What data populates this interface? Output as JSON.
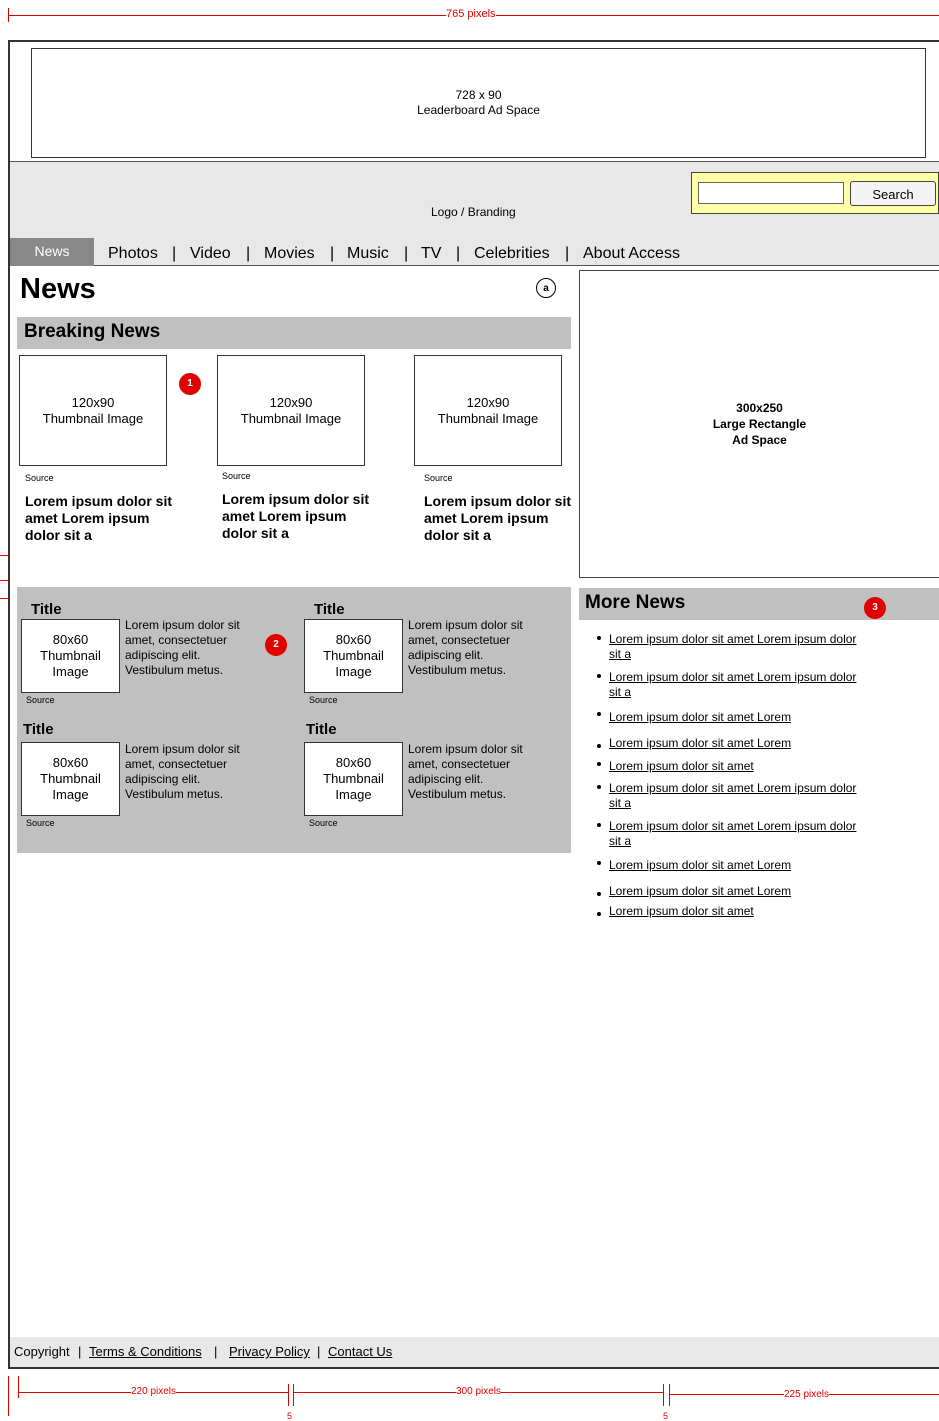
{
  "dimensions": {
    "total_width": "765 pixels",
    "col1": "220 pixels",
    "col2": "300 pixels",
    "col3": "225 pixels",
    "gap1": "5",
    "gap2": "5"
  },
  "leaderboard": {
    "line1": "728 x 90",
    "line2": "Leaderboard Ad Space"
  },
  "header": {
    "logo": "Logo / Branding",
    "search_button": "Search",
    "search_value": ""
  },
  "nav": {
    "active": "News",
    "items": [
      "Photos",
      "Video",
      "Movies",
      "Music",
      "TV",
      "Celebrities",
      "About Access"
    ],
    "separator": "|"
  },
  "page": {
    "title": "News",
    "marker_a": "a"
  },
  "breaking": {
    "heading": "Breaking News",
    "marker": "1",
    "items": [
      {
        "thumb_size": "120x90",
        "thumb_label": "Thumbnail Image",
        "source": "Source",
        "headline": "Lorem ipsum dolor sit amet Lorem ipsum dolor sit a"
      },
      {
        "thumb_size": "120x90",
        "thumb_label": "Thumbnail Image",
        "source": "Source",
        "headline": "Lorem ipsum dolor sit amet Lorem ipsum dolor sit a"
      },
      {
        "thumb_size": "120x90",
        "thumb_label": "Thumbnail Image",
        "source": "Source",
        "headline": "Lorem ipsum dolor sit amet Lorem ipsum dolor sit a"
      }
    ]
  },
  "stories": {
    "marker": "2",
    "items": [
      {
        "title": "Title",
        "thumb_size": "80x60",
        "thumb_l1": "Thumbnail",
        "thumb_l2": "Image",
        "source": "Source",
        "text": "Lorem ipsum dolor sit amet, consectetuer adipiscing elit. Vestibulum metus."
      },
      {
        "title": "Title",
        "thumb_size": "80x60",
        "thumb_l1": "Thumbnail",
        "thumb_l2": "Image",
        "source": "Source",
        "text": "Lorem ipsum dolor sit amet, consectetuer adipiscing elit. Vestibulum metus."
      },
      {
        "title": "Title",
        "thumb_size": "80x60",
        "thumb_l1": "Thumbnail",
        "thumb_l2": "Image",
        "source": "Source",
        "text": "Lorem ipsum dolor sit amet, consectetuer adipiscing elit. Vestibulum metus."
      },
      {
        "title": "Title",
        "thumb_size": "80x60",
        "thumb_l1": "Thumbnail",
        "thumb_l2": "Image",
        "source": "Source",
        "text": "Lorem ipsum dolor sit amet, consectetuer adipiscing elit. Vestibulum metus."
      }
    ]
  },
  "ad_rect": {
    "line1": "300x250",
    "line2": "Large Rectangle",
    "line3": "Ad Space"
  },
  "more_news": {
    "heading": "More News",
    "marker": "3",
    "links": [
      "Lorem ipsum dolor sit amet Lorem ipsum dolor sit a",
      "Lorem ipsum dolor sit amet Lorem ipsum dolor sit a",
      "Lorem ipsum dolor sit amet Lorem",
      "Lorem ipsum dolor sit amet Lorem",
      "Lorem ipsum dolor sit amet",
      "Lorem ipsum dolor sit amet Lorem ipsum dolor sit a",
      "Lorem ipsum dolor sit amet Lorem ipsum dolor sit a",
      "Lorem ipsum dolor sit amet Lorem",
      "Lorem ipsum dolor sit amet Lorem",
      "Lorem ipsum dolor sit amet"
    ]
  },
  "footer": {
    "copyright": "Copyright",
    "links": [
      "Terms & Conditions",
      "Privacy Policy",
      "Contact Us"
    ],
    "separator": "|"
  },
  "colors": {
    "annotation": "#e00000",
    "search_bg": "#ffffa8",
    "panel_grey": "#c0c0c0",
    "band_grey": "#e8e8e8",
    "nav_active": "#888888"
  }
}
